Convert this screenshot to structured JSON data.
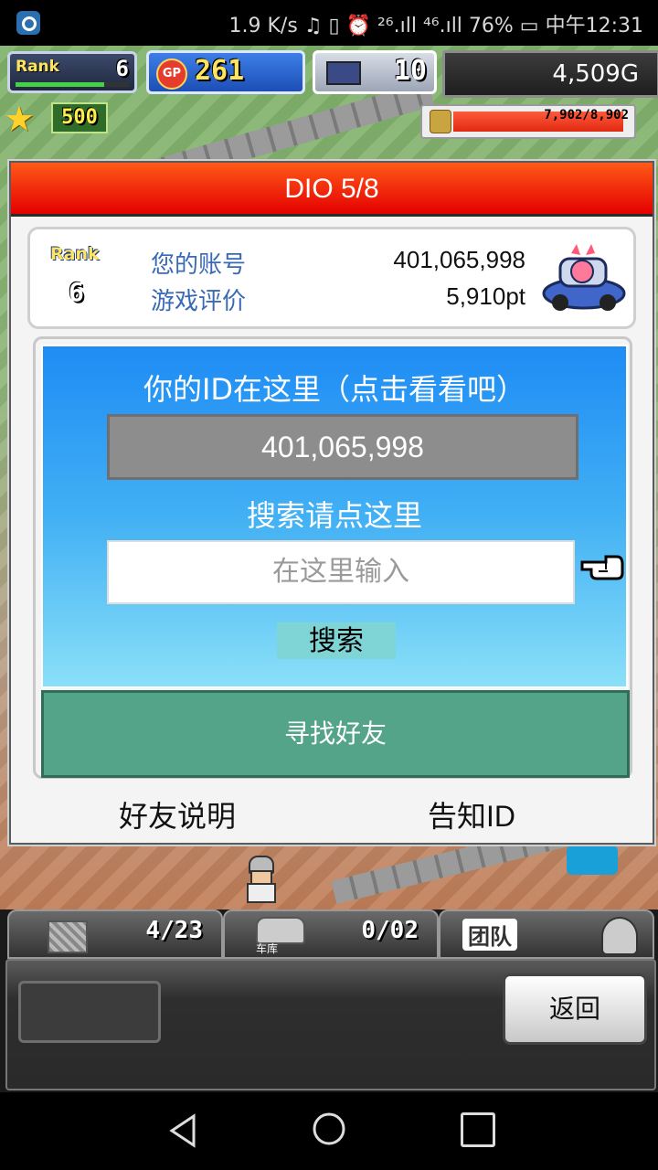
{
  "status_bar": {
    "text": "1.9 K/s ♫ ▯ ⏰ ²⁶.ıll ⁴⁶.ıll 76% ▭ 中午12:31"
  },
  "hud": {
    "rank_label": "Rank",
    "rank_value": "6",
    "gp_label": "GP",
    "gp_value": "261",
    "pc_value": "10",
    "money": "4,509G",
    "star_value": "500",
    "energy_value": "7,902/8,902"
  },
  "dialog": {
    "title": "DIO 5/8",
    "profile": {
      "rank_label": "Rank",
      "rank_value": "6",
      "account_label": "您的账号",
      "account_value": "401,065,998",
      "rating_label": "游戏评价",
      "rating_value": "5,910pt"
    },
    "id_hint": "你的ID在这里（点击看看吧）",
    "id_value": "401,065,998",
    "search_hint": "搜索请点这里",
    "search_placeholder": "在这里输入",
    "search_button": "搜索",
    "find_friend_button": "寻找好友",
    "friend_help_link": "好友说明",
    "share_id_link": "告知ID"
  },
  "bottom_tabs": {
    "materials_count": "4/23",
    "garage_label": "车库",
    "garage_count": "0/02",
    "team_label": "团队"
  },
  "action_panel": {
    "return_button": "返回"
  },
  "colors": {
    "title_red": "#e40000",
    "id_blue": "#1e8cf4",
    "find_friend_green": "#54a48a",
    "search_button_cyan": "#7fd4d6"
  }
}
